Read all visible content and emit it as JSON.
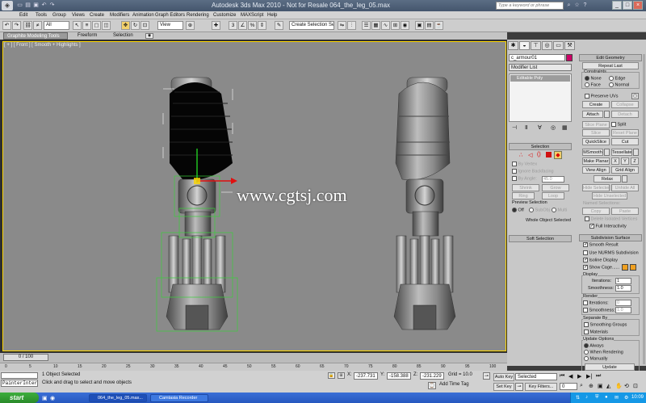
{
  "window": {
    "title": "Autodesk 3ds Max  2010  - Not for Resale   064_the_leg_05.max",
    "search_placeholder": "Type a keyword or phrase"
  },
  "menu": [
    "Edit",
    "Tools",
    "Group",
    "Views",
    "Create",
    "Modifiers",
    "Animation",
    "Graph Editors",
    "Rendering",
    "Customize",
    "MAXScript",
    "Help"
  ],
  "toolbar": {
    "filter": "All",
    "refcoord": "View",
    "selset": "Create Selection Se"
  },
  "ribbon": {
    "tabs": [
      "Graphite Modeling Tools",
      "Freeform",
      "Selection"
    ]
  },
  "viewport": {
    "label": "[ + ] [ Front ] [ Smooth + Highlights ]"
  },
  "watermark": "www.cgtsj.com",
  "command_panel": {
    "object_name": "c_armour01",
    "modifier_list": "Modifier List",
    "stack_item": "Editable Poly",
    "selection": {
      "header": "Selection",
      "by_vertex": "By Vertex",
      "ignore_backfacing": "Ignore Backfacing",
      "by_angle": "By Angle:",
      "by_angle_value": "45.0",
      "shrink": "Shrink",
      "grow": "Grow",
      "ring": "Ring",
      "loop": "Loop",
      "preview": "Preview Selection",
      "off": "Off",
      "subobj": "SubObj",
      "multi": "Multi",
      "whole": "Whole Object Selected"
    },
    "soft_selection": "Soft Selection",
    "edit_geometry": {
      "header": "Edit Geometry",
      "repeat_last": "Repeat Last",
      "constraints": "Constraints",
      "none": "None",
      "edge": "Edge",
      "face": "Face",
      "normal": "Normal",
      "preserve_uvs": "Preserve UVs",
      "create": "Create",
      "collapse": "Collapse",
      "attach": "Attach",
      "detach": "Detach",
      "slice_plane": "Slice Plane",
      "split": "Split",
      "slice": "Slice",
      "reset_plane": "Reset Plane",
      "quickslice": "QuickSlice",
      "cut": "Cut",
      "msmooth": "MSmooth",
      "tessellate": "Tessellate",
      "make_planar": "Make Planar",
      "x": "X",
      "y": "Y",
      "z": "Z",
      "view_align": "View Align",
      "grid_align": "Grid Align",
      "relax": "Relax",
      "hide_selected": "Hide Selected",
      "unhide_all": "Unhide All",
      "hide_unselected": "Hide Unselected",
      "named_selections": "Named Selections:",
      "copy": "Copy",
      "paste": "Paste",
      "delete_isolated": "Delete Isolated Vertices",
      "full_interactivity": "Full Interactivity"
    },
    "subdivision": {
      "header": "Subdivision Surface",
      "smooth_result": "Smooth Result",
      "use_nurms": "Use NURMS Subdivision",
      "isoline": "Isoline Display",
      "show_cage": "Show Cage......",
      "display": "Display",
      "iterations": "Iterations:",
      "iterations_value": "1",
      "smoothness": "Smoothness:",
      "smoothness_value": "1.0",
      "render": "Render",
      "r_iterations_value": "0",
      "r_smoothness_value": "1.0",
      "separate_by": "Separate By",
      "smoothing_groups": "Smoothing Groups",
      "materials": "Materials",
      "update_options": "Update Options",
      "always": "Always",
      "when_rendering": "When Rendering",
      "manually": "Manually",
      "update": "Update"
    }
  },
  "timeline": {
    "frame": "0 / 100",
    "ticks": [
      "0",
      "5",
      "10",
      "15",
      "20",
      "25",
      "30",
      "35",
      "40",
      "45",
      "50",
      "55",
      "60",
      "65",
      "70",
      "75",
      "80",
      "85",
      "90",
      "95",
      "100"
    ]
  },
  "status": {
    "objects": "1 Object Selected",
    "prompt": "Click and drag to select and move objects",
    "x": "-237.731",
    "y": "-158.388",
    "z": "-231.229",
    "grid": "Grid = 10.0",
    "autokey": "Auto Key",
    "setkey": "Set Key",
    "selected": "Selected",
    "key_filters": "Key Filters...",
    "add_time_tag": "Add Time Tag",
    "painter": "PainterInter",
    "frame_value": "0"
  },
  "taskbar": {
    "start": "start",
    "items": [
      "064_the_leg_05.max...",
      "Camtasia Recorder"
    ],
    "clock": "10:09"
  },
  "colors": {
    "accent": "#ffd700",
    "viewport_bg": "#8a8a8a",
    "cage": "#f0a020",
    "selection_red": "#d01010"
  }
}
